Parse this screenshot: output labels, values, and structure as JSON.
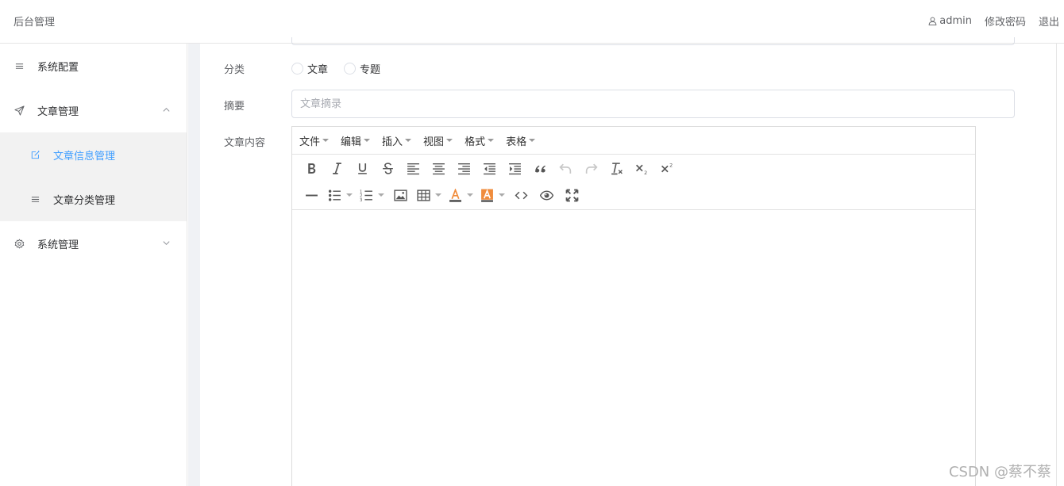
{
  "header": {
    "brand": "后台管理",
    "user": "admin",
    "change_password": "修改密码",
    "logout": "退出"
  },
  "sidebar": {
    "items": [
      {
        "label": "系统配置",
        "icon": "menu-icon"
      },
      {
        "label": "文章管理",
        "icon": "send-icon",
        "expanded": true
      },
      {
        "label": "文章信息管理",
        "icon": "edit-icon",
        "active": true
      },
      {
        "label": "文章分类管理",
        "icon": "menu-icon"
      },
      {
        "label": "系统管理",
        "icon": "gear-icon",
        "expanded": false
      }
    ]
  },
  "form": {
    "category_label": "分类",
    "category_options": [
      "文章",
      "专题"
    ],
    "summary_label": "摘要",
    "summary_placeholder": "文章摘录",
    "content_label": "文章内容"
  },
  "editor": {
    "menubar": [
      "文件",
      "编辑",
      "插入",
      "视图",
      "格式",
      "表格"
    ]
  },
  "watermark": "CSDN @蔡不蔡",
  "colors": {
    "accent": "#409eff",
    "submenu_bg": "#f2f2f2",
    "gap_bg": "#f0f2f5",
    "font_color_swatch": "#f08c3c"
  }
}
